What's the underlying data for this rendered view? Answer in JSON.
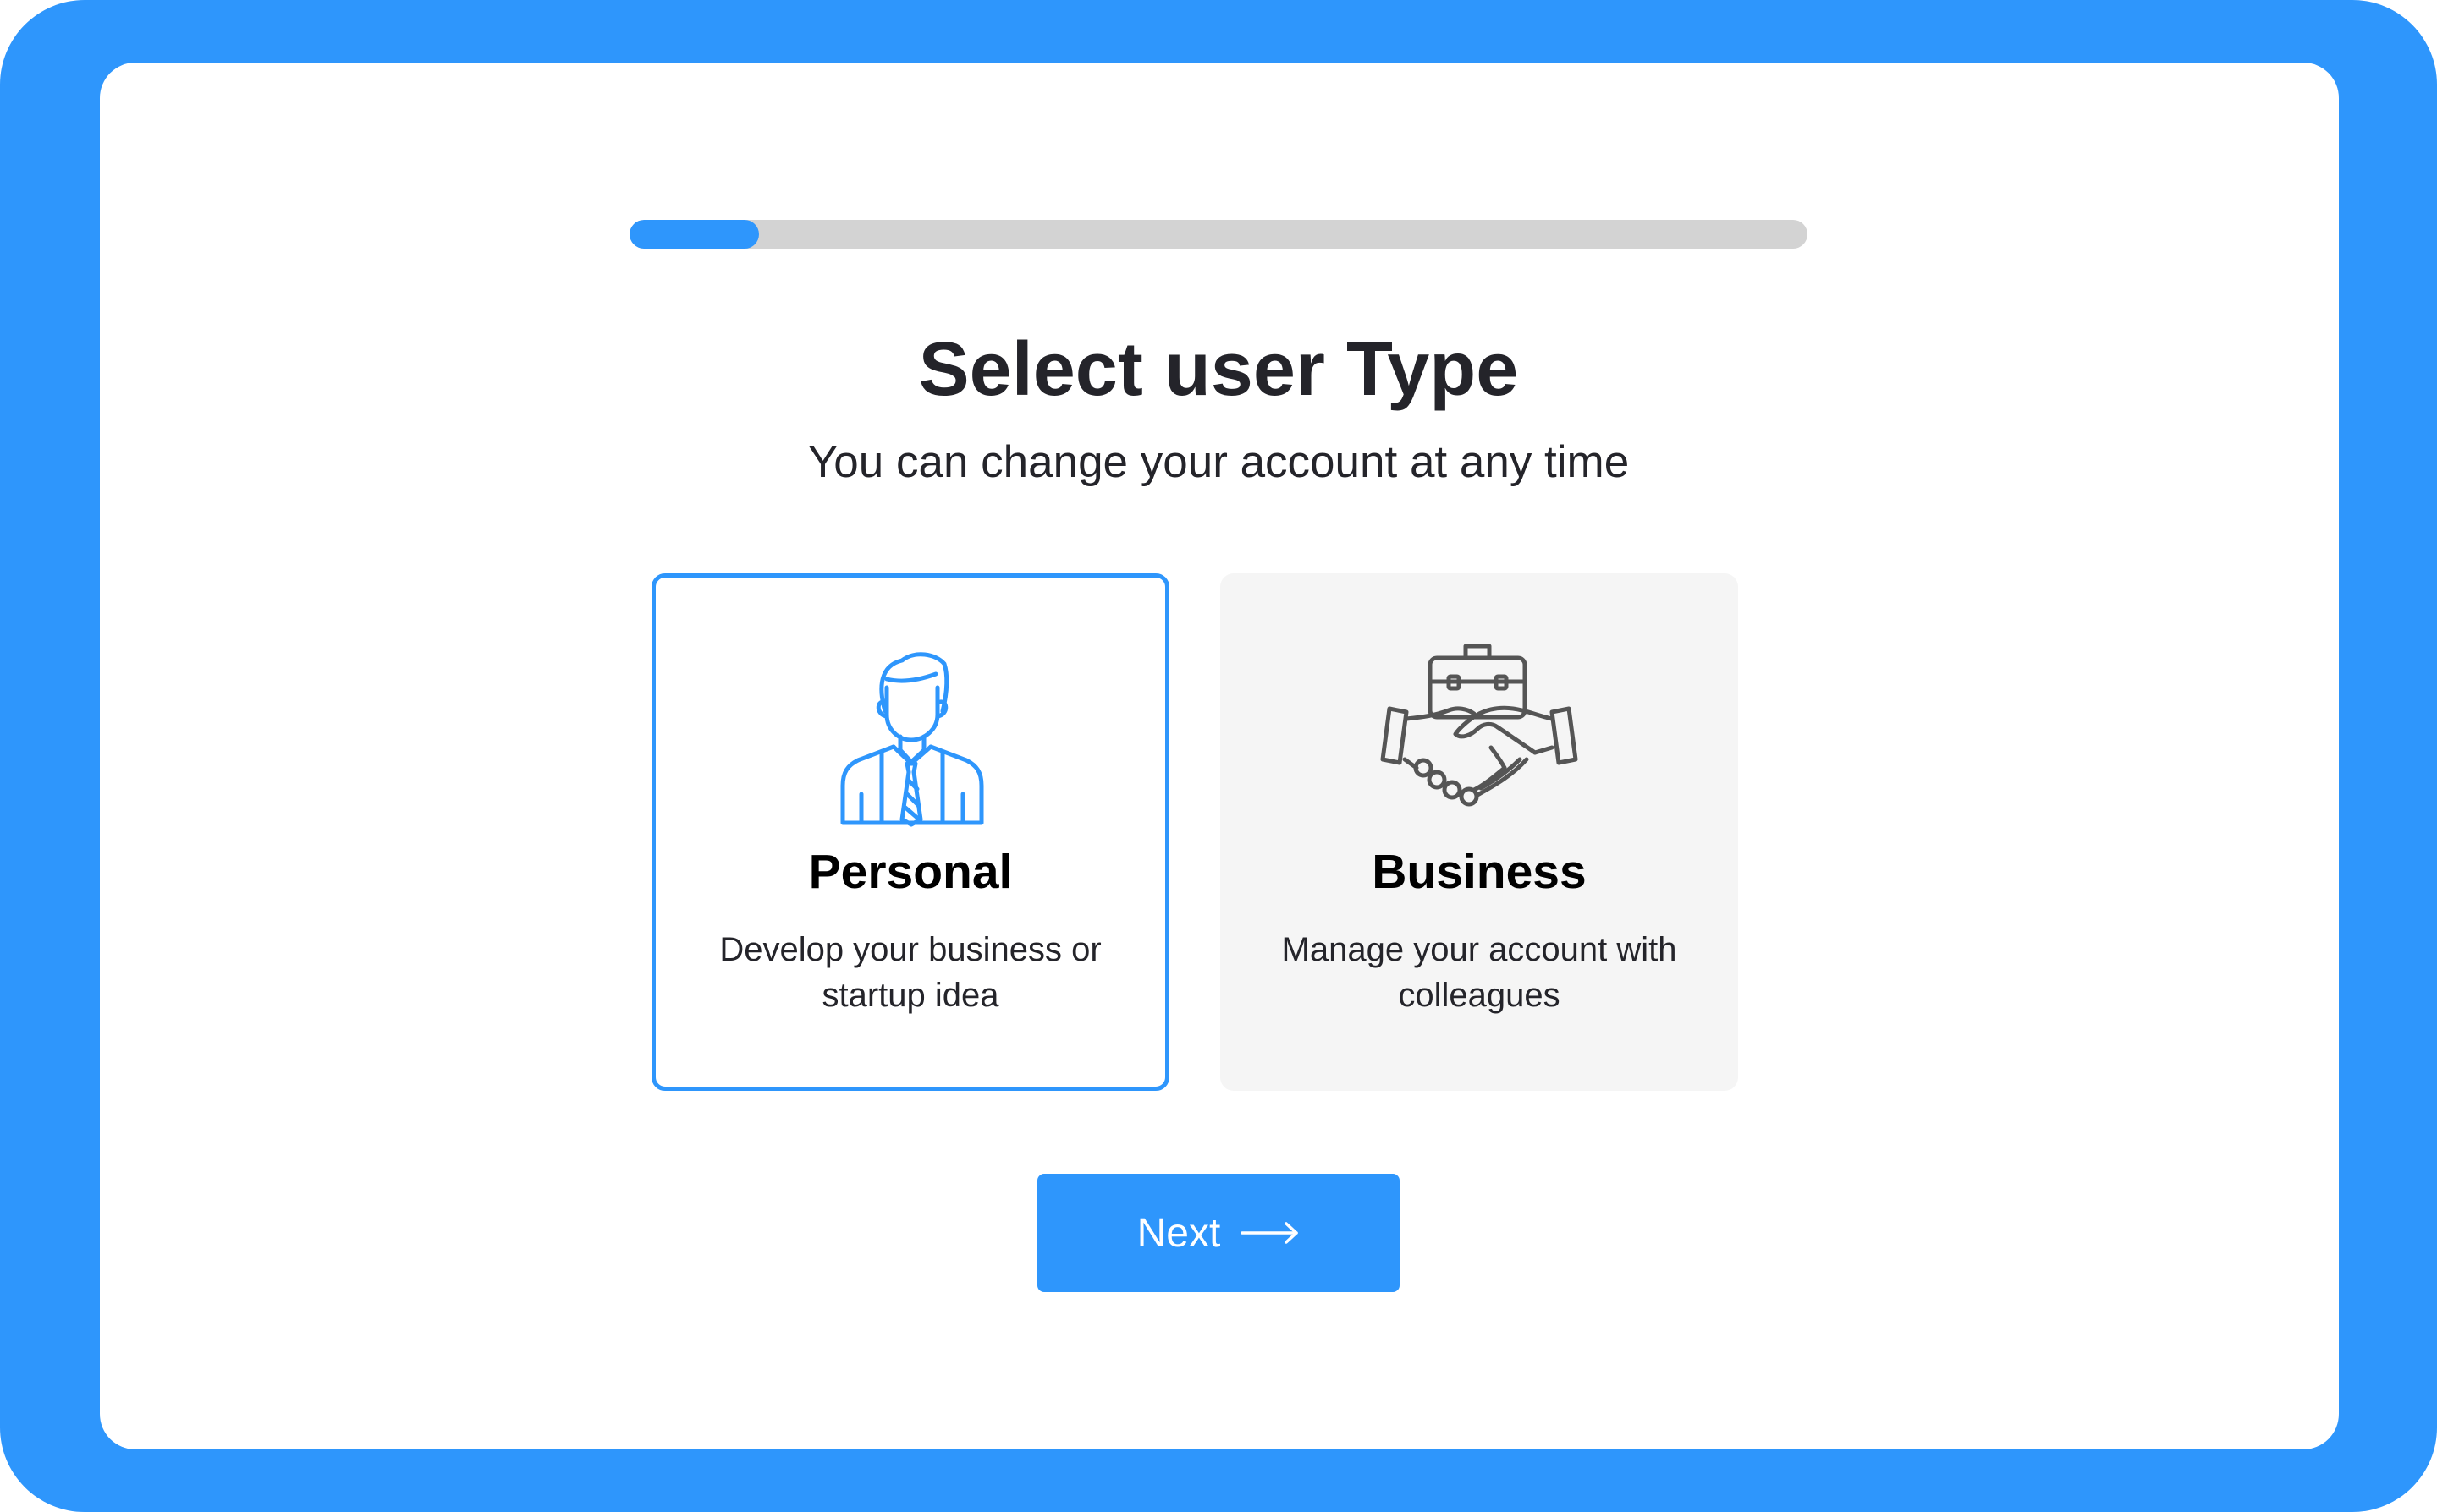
{
  "progress": {
    "value": 0.11
  },
  "header": {
    "title": "Select user Type",
    "subtitle": "You can change your account at any time"
  },
  "options": [
    {
      "title": "Personal",
      "description": "Develop your business or startup idea",
      "icon": "person-with-tie-icon",
      "selected": true
    },
    {
      "title": "Business",
      "description": "Manage your account with colleagues",
      "icon": "briefcase-handshake-icon",
      "selected": false
    }
  ],
  "next_button": {
    "label": "Next",
    "icon": "arrow-right-icon"
  },
  "colors": {
    "accent": "#2e96fc",
    "track": "#d3d3d3",
    "selected_icon": "#2e96fc",
    "unselected_icon": "#555555",
    "unselected_card_bg": "#f5f5f5"
  }
}
